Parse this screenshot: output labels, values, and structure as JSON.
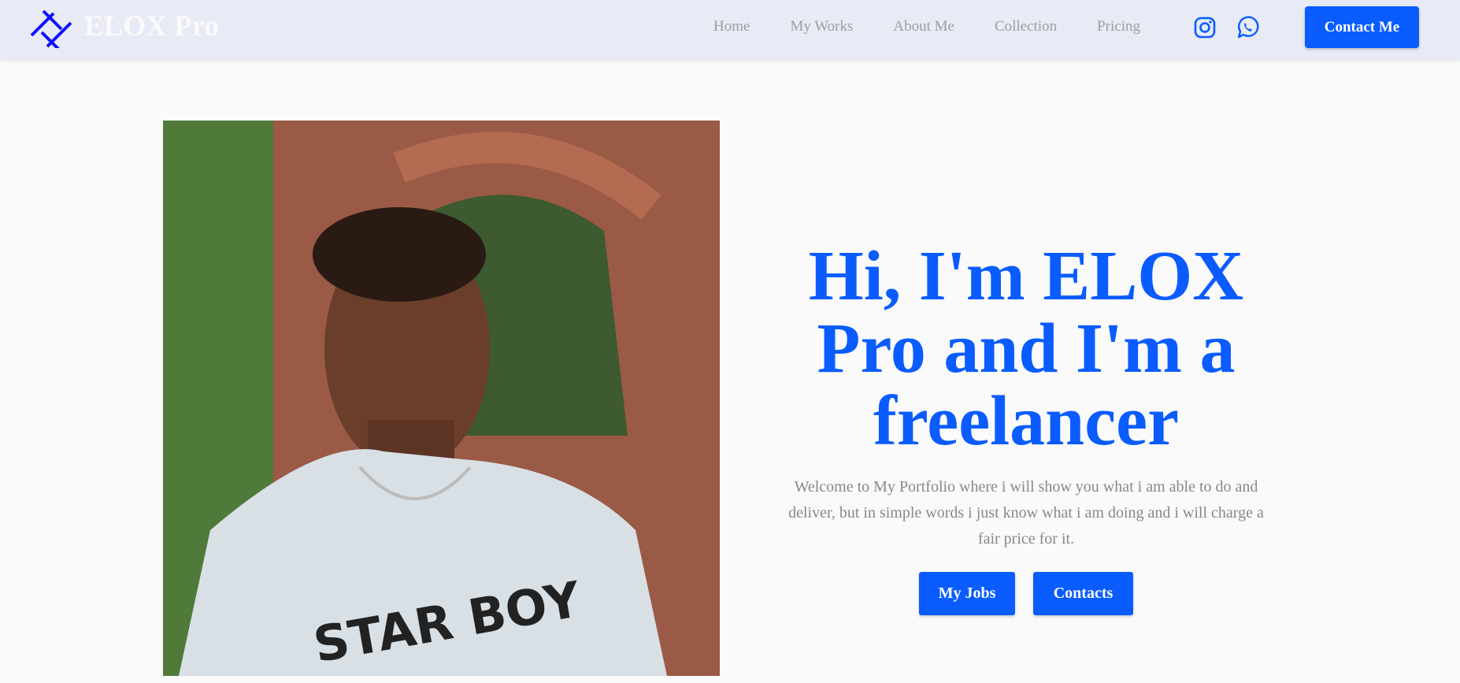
{
  "nav": {
    "brand": "ELOX Pro",
    "links": [
      "Home",
      "My Works",
      "About Me",
      "Collection",
      "Pricing"
    ],
    "contact_label": "Contact Me",
    "social": [
      "instagram-icon",
      "whatsapp-icon"
    ]
  },
  "hero": {
    "heading": "Hi, I'm ELOX Pro and I'm a freelancer",
    "description": "Welcome to My Portfolio where i will show you  what i am able to do and deliver, but in simple words i just know what i am doing and i will charge a fair price for it.",
    "buttons": [
      "My Jobs",
      "Contacts"
    ],
    "shirt_text": "STAR BOY"
  },
  "colors": {
    "accent": "#0a5cff",
    "nav_bg": "#e8eaf6"
  }
}
